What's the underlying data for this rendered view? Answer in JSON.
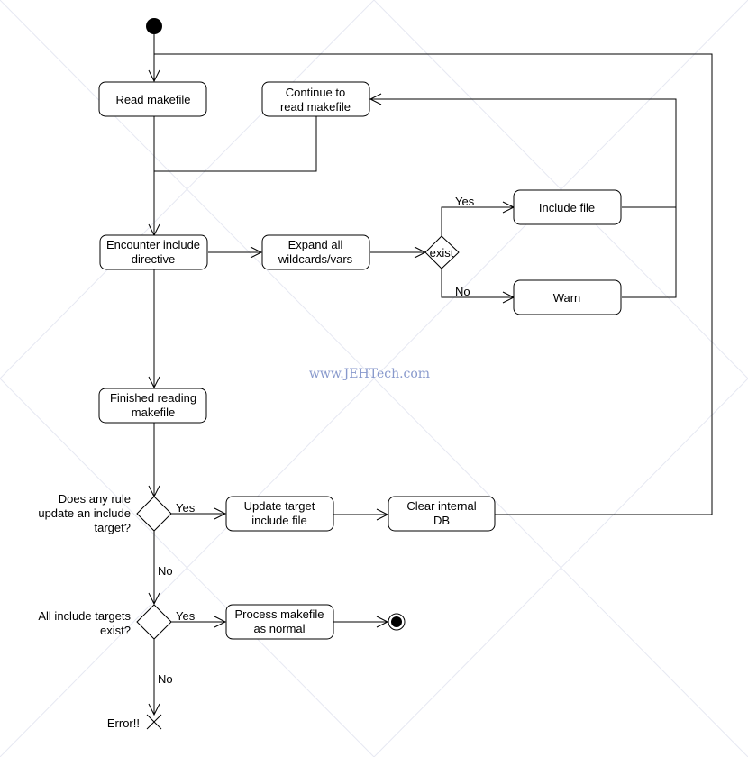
{
  "diagram": {
    "type": "uml-activity",
    "watermark": "www.JEHTech.com",
    "colors": {
      "stroke": "#000000",
      "watermark": "#8899cc",
      "background": "#ffffff"
    },
    "nodes": {
      "start": {
        "kind": "initial"
      },
      "read_makefile": {
        "kind": "action",
        "lines": [
          "Read makefile"
        ]
      },
      "continue_read": {
        "kind": "action",
        "lines": [
          "Continue to",
          "read makefile"
        ]
      },
      "encounter_include": {
        "kind": "action",
        "lines": [
          "Encounter include",
          "directive"
        ]
      },
      "expand_wildcards": {
        "kind": "action",
        "lines": [
          "Expand all",
          "wildcards/vars"
        ]
      },
      "exist_decision": {
        "kind": "decision",
        "label": "exist"
      },
      "include_file": {
        "kind": "action",
        "lines": [
          "Include file"
        ]
      },
      "warn": {
        "kind": "action",
        "lines": [
          "Warn"
        ]
      },
      "finished_reading": {
        "kind": "action",
        "lines": [
          "Finished reading",
          "makefile"
        ]
      },
      "rule_update_decision": {
        "kind": "decision",
        "lines": [
          "Does any rule",
          "update an include",
          "target?"
        ]
      },
      "update_target": {
        "kind": "action",
        "lines": [
          "Update target",
          "include file"
        ]
      },
      "clear_db": {
        "kind": "action",
        "lines": [
          "Clear internal",
          "DB"
        ]
      },
      "all_exist_decision": {
        "kind": "decision",
        "lines": [
          "All include targets",
          "exist?"
        ]
      },
      "process_makefile": {
        "kind": "action",
        "lines": [
          "Process makefile",
          "as normal"
        ]
      },
      "end": {
        "kind": "final"
      },
      "error": {
        "kind": "flow-final",
        "label": "Error!!"
      }
    },
    "edges": [
      {
        "from": "start",
        "to": "read_makefile"
      },
      {
        "from": "read_makefile",
        "to": "encounter_include"
      },
      {
        "from": "continue_read",
        "to": "encounter_include"
      },
      {
        "from": "encounter_include",
        "to": "expand_wildcards"
      },
      {
        "from": "expand_wildcards",
        "to": "exist_decision"
      },
      {
        "from": "exist_decision",
        "to": "include_file",
        "guard": "Yes"
      },
      {
        "from": "exist_decision",
        "to": "warn",
        "guard": "No"
      },
      {
        "from": "include_file",
        "to": "continue_read"
      },
      {
        "from": "warn",
        "to": "continue_read"
      },
      {
        "from": "encounter_include",
        "to": "finished_reading"
      },
      {
        "from": "finished_reading",
        "to": "rule_update_decision"
      },
      {
        "from": "rule_update_decision",
        "to": "update_target",
        "guard": "Yes"
      },
      {
        "from": "update_target",
        "to": "clear_db"
      },
      {
        "from": "clear_db",
        "to": "read_makefile"
      },
      {
        "from": "rule_update_decision",
        "to": "all_exist_decision",
        "guard": "No"
      },
      {
        "from": "all_exist_decision",
        "to": "process_makefile",
        "guard": "Yes"
      },
      {
        "from": "process_makefile",
        "to": "end"
      },
      {
        "from": "all_exist_decision",
        "to": "error",
        "guard": "No"
      }
    ]
  }
}
